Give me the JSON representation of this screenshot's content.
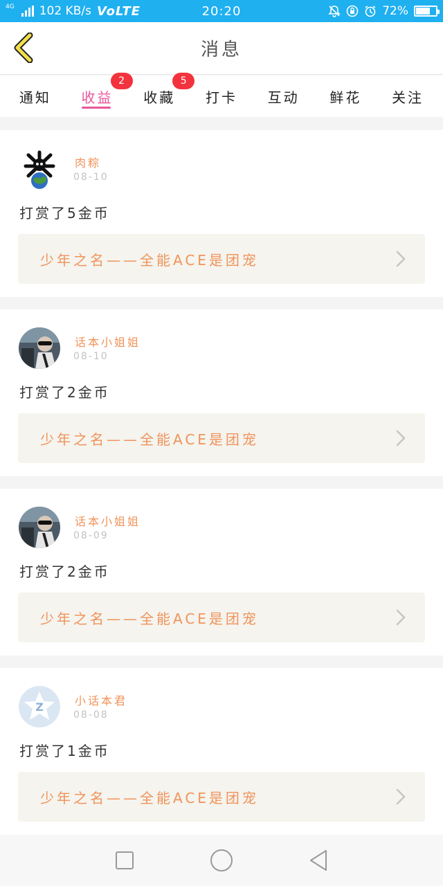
{
  "status_bar": {
    "network": "4G",
    "speed": "102 KB/s",
    "volte": "VoLTE",
    "time": "20:20",
    "battery": "72%",
    "battery_level": 0.72
  },
  "header": {
    "title": "消息",
    "back_icon": "chevron-left-icon"
  },
  "tabs": [
    {
      "label": "通知",
      "badge": ""
    },
    {
      "label": "收益",
      "badge": "2",
      "active": true
    },
    {
      "label": "收藏",
      "badge": "5"
    },
    {
      "label": "打卡",
      "badge": ""
    },
    {
      "label": "互动",
      "badge": ""
    },
    {
      "label": "鲜花",
      "badge": ""
    },
    {
      "label": "关注",
      "badge": ""
    }
  ],
  "messages": [
    {
      "user": "肉粽",
      "time": "08-10",
      "text": "打赏了5金币",
      "link": "少年之名——全能ACE是团宠",
      "avatar": "skull-avatar"
    },
    {
      "user": "话本小姐姐",
      "time": "08-10",
      "text": "打赏了2金币",
      "link": "少年之名——全能ACE是团宠",
      "avatar": "photo-avatar"
    },
    {
      "user": "话本小姐姐",
      "time": "08-09",
      "text": "打赏了2金币",
      "link": "少年之名——全能ACE是团宠",
      "avatar": "photo-avatar"
    },
    {
      "user": "小话本君",
      "time": "08-08",
      "text": "打赏了1金币",
      "link": "少年之名——全能ACE是团宠",
      "avatar": "default-avatar"
    }
  ],
  "colors": {
    "status_bar": "#1fb0f0",
    "accent": "#e8569c",
    "badge": "#f2333e",
    "username": "#f0935b",
    "link_bg": "#f5f4ee"
  }
}
